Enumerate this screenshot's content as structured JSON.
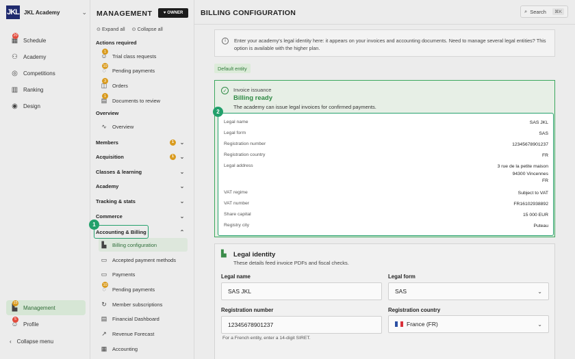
{
  "sidebar": {
    "academy_name": "JKL Academy",
    "logo_text": "JKL",
    "items": [
      {
        "label": "Schedule",
        "icon": "calendar-icon",
        "badge": "20"
      },
      {
        "label": "Academy",
        "icon": "users-icon",
        "badge": ""
      },
      {
        "label": "Competitions",
        "icon": "trophy-icon",
        "badge": ""
      },
      {
        "label": "Ranking",
        "icon": "ranking-icon",
        "badge": ""
      },
      {
        "label": "Design",
        "icon": "palette-icon",
        "badge": ""
      }
    ],
    "management": {
      "label": "Management",
      "badge": "15"
    },
    "profile": {
      "label": "Profile",
      "badge": "5"
    },
    "collapse_label": "Collapse menu"
  },
  "management_panel": {
    "title": "MANAGEMENT",
    "owner_label": "OWNER",
    "expand_all": "Expand all",
    "collapse_all": "Collapse all",
    "actions_required_label": "Actions required",
    "actions": [
      {
        "label": "Trial class requests",
        "badge": "1"
      },
      {
        "label": "Pending payments",
        "badge": "10"
      },
      {
        "label": "Orders",
        "badge": "3"
      },
      {
        "label": "Documents to review",
        "badge": "1"
      }
    ],
    "overview_section": "Overview",
    "overview_item": "Overview",
    "groups": [
      {
        "label": "Members",
        "badge": "1"
      },
      {
        "label": "Acquisition",
        "badge": "1"
      },
      {
        "label": "Classes & learning",
        "badge": ""
      },
      {
        "label": "Academy",
        "badge": ""
      },
      {
        "label": "Tracking & stats",
        "badge": ""
      },
      {
        "label": "Commerce",
        "badge": ""
      },
      {
        "label": "Accounting & Billing",
        "badge": ""
      }
    ],
    "accounting_items": [
      {
        "label": "Billing configuration",
        "badge": ""
      },
      {
        "label": "Accepted payment methods",
        "badge": ""
      },
      {
        "label": "Payments",
        "badge": ""
      },
      {
        "label": "Pending payments",
        "badge": "10"
      },
      {
        "label": "Member subscriptions",
        "badge": ""
      },
      {
        "label": "Financial Dashboard",
        "badge": ""
      },
      {
        "label": "Revenue Forecast",
        "badge": ""
      },
      {
        "label": "Accounting",
        "badge": ""
      }
    ]
  },
  "main": {
    "title": "BILLING CONFIGURATION",
    "search_label": "Search",
    "search_shortcut": "⌘K",
    "info_text": "Enter your academy's legal identity here: it appears on your invoices and accounting documents. Need to manage several legal entities? This option is available with the higher plan.",
    "default_entity_label": "Default entity",
    "invoice_issuance": {
      "label": "Invoice issuance",
      "status": "Billing ready",
      "description": "The academy can issue legal invoices for confirmed payments."
    },
    "details": [
      {
        "key": "Legal name",
        "value": "SAS JKL"
      },
      {
        "key": "Legal form",
        "value": "SAS"
      },
      {
        "key": "Registration number",
        "value": "12345678901237"
      },
      {
        "key": "Registration country",
        "value": "FR"
      },
      {
        "key": "Legal address",
        "value": "3 rue de la petite maison\n94300 Vincennes\nFR"
      },
      {
        "key": "VAT regime",
        "value": "Subject to VAT"
      },
      {
        "key": "VAT number",
        "value": "FR16102938892"
      },
      {
        "key": "Share capital",
        "value": "15 000 EUR"
      },
      {
        "key": "Registry city",
        "value": "Puteau"
      }
    ],
    "legal_identity": {
      "title": "Legal identity",
      "subtitle": "These details feed invoice PDFs and fiscal checks.",
      "legal_name_label": "Legal name",
      "legal_name_value": "SAS JKL",
      "legal_form_label": "Legal form",
      "legal_form_value": "SAS",
      "registration_number_label": "Registration number",
      "registration_number_value": "12345678901237",
      "registration_number_hint": "For a French entity, enter a 14-digit SIRET.",
      "registration_country_label": "Registration country",
      "registration_country_value": "France (FR)"
    }
  },
  "steps": {
    "one": "1",
    "two": "2"
  },
  "colors": {
    "accent": "#22a06b",
    "brand": "#1f2a6e",
    "badge_red": "#e24a3b",
    "badge_orange": "#d99b1f"
  }
}
